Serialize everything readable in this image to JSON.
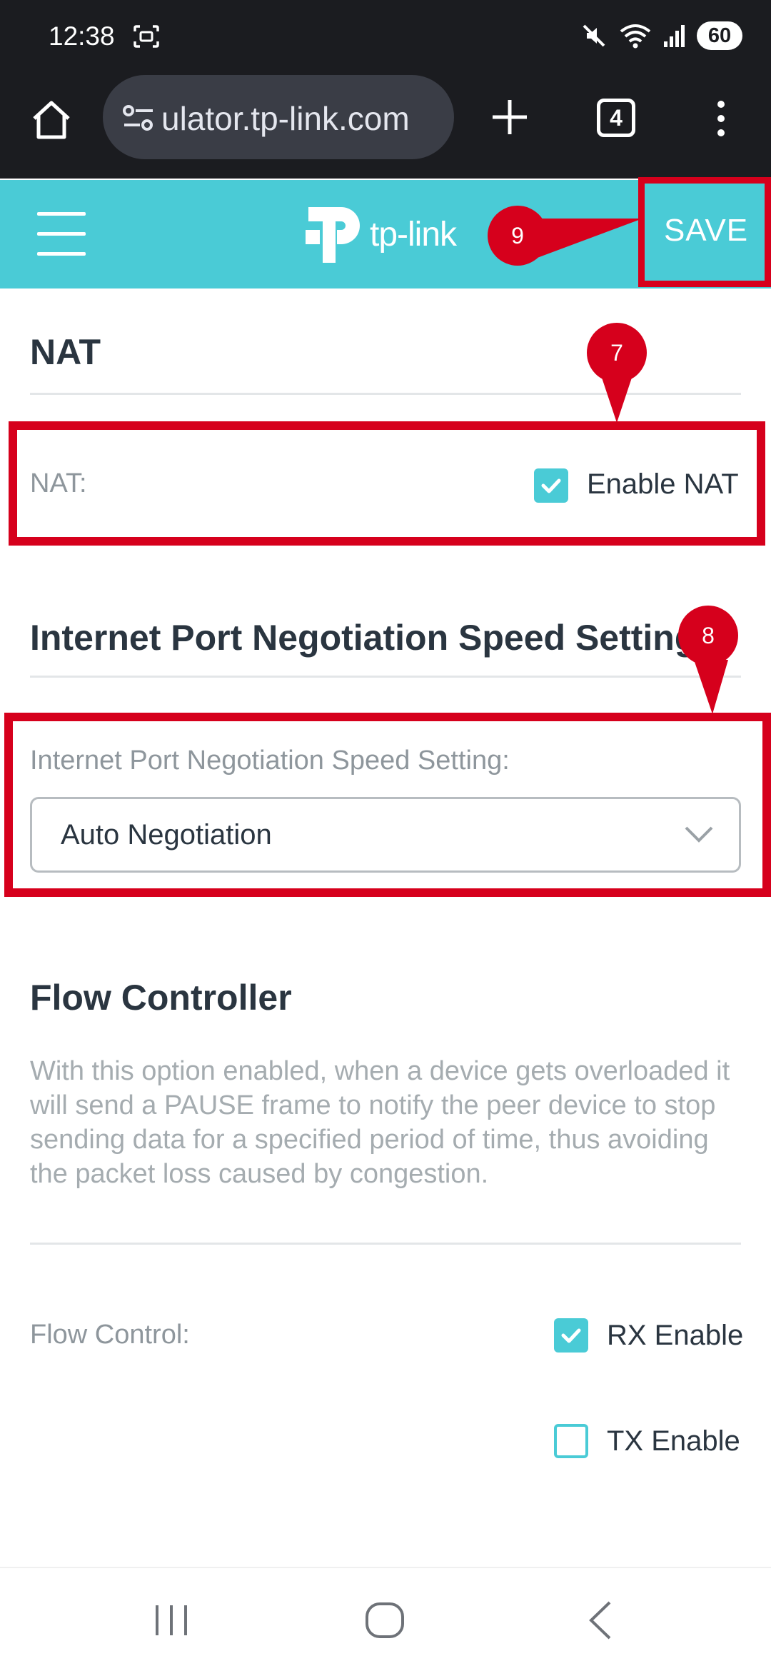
{
  "status_bar": {
    "time": "12:38",
    "battery": "60"
  },
  "browser": {
    "url": "ulator.tp-link.com",
    "tab_count": "4"
  },
  "app_header": {
    "logo_text": "tp-link",
    "save_label": "SAVE"
  },
  "annotations": {
    "nat_marker": "7",
    "speed_marker": "8",
    "save_marker": "9"
  },
  "nat": {
    "title": "NAT",
    "label": "NAT:",
    "checkbox_label": "Enable NAT",
    "checked": true
  },
  "speed": {
    "title": "Internet Port Negotiation Speed Setting",
    "label": "Internet Port Negotiation Speed Setting:",
    "selected": "Auto Negotiation"
  },
  "flow": {
    "title": "Flow Controller",
    "description": "With this option enabled, when a device gets overloaded it will send a PAUSE frame to notify the peer device to stop sending data for a specified period of time, thus avoiding the packet loss caused by congestion.",
    "label": "Flow Control:",
    "rx_label": "RX Enable",
    "rx_checked": true,
    "tx_label": "TX Enable",
    "tx_checked": false
  },
  "colors": {
    "accent": "#4acbd6",
    "annotation_red": "#d6001c",
    "heading": "#2a3540"
  }
}
